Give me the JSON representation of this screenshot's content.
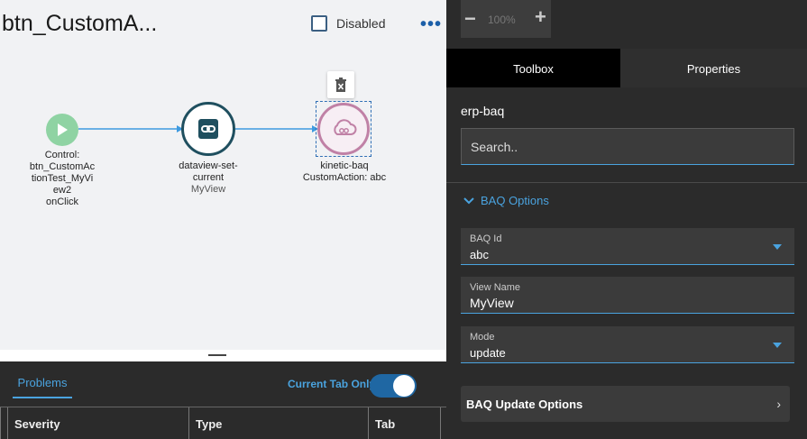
{
  "flow": {
    "title": "btn_CustomA...",
    "disabled_label": "Disabled"
  },
  "nodes": {
    "start": {
      "lines": [
        "Control:",
        "btn_CustomAc",
        "tionTest_MyVi",
        "ew2",
        "onClick"
      ]
    },
    "dataview": {
      "name_line1": "dataview-set-",
      "name_line2": "current",
      "sub": "MyView"
    },
    "kinetic": {
      "name": "kinetic-baq",
      "sub": "CustomAction: abc"
    }
  },
  "problems": {
    "tab_label": "Problems",
    "current_tab_only_label": "Current Tab Only",
    "toggle_on": true,
    "columns": [
      "Severity",
      "Type",
      "Tab"
    ]
  },
  "zoom": {
    "value": "100%",
    "minus": "−",
    "plus": "+"
  },
  "panel": {
    "tabs": [
      "Toolbox",
      "Properties"
    ],
    "active_tab": "Toolbox",
    "component_name": "erp-baq",
    "search_placeholder": "Search..",
    "section_title": "BAQ Options",
    "fields": [
      {
        "label": "BAQ Id",
        "value": "abc",
        "type": "select"
      },
      {
        "label": "View Name",
        "value": "MyView",
        "type": "text"
      },
      {
        "label": "Mode",
        "value": "update",
        "type": "select"
      }
    ],
    "collapsed_section": "BAQ Update Options",
    "collapsed_arrow": "›"
  },
  "colors": {
    "accent": "#4aa3df",
    "start_node": "#8fd3a3",
    "dataview_node": "#1f4f5f",
    "kinetic_node": "#c081a6",
    "edge": "#3d9ae0"
  }
}
